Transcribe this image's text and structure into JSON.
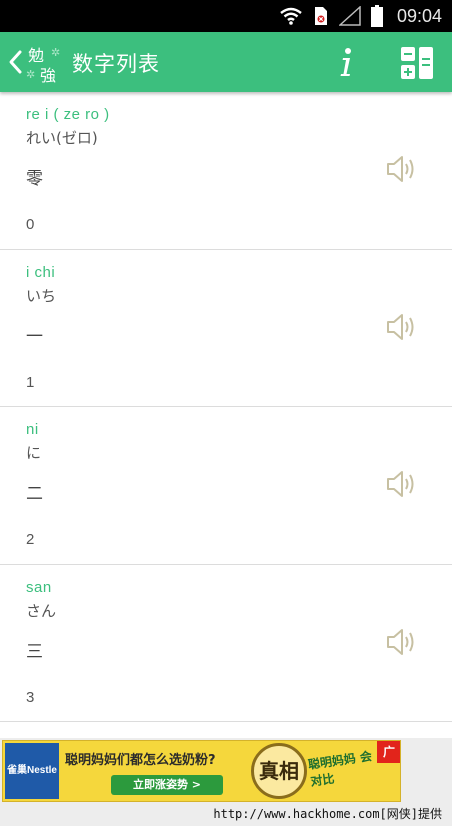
{
  "status_bar": {
    "time": "09:04",
    "icons": [
      "wifi-icon",
      "sim-icon",
      "signal-icon",
      "battery-icon"
    ]
  },
  "app_bar": {
    "logo_text": [
      "勉",
      "強"
    ],
    "title": "数字列表",
    "back_icon": "chevron-left-icon",
    "info_icon": "info-icon",
    "calculator_icon": "calculator-icon",
    "color": "#3cbf7e"
  },
  "numbers": [
    {
      "romaji": "re i ( ze ro )",
      "kana": "れい(ゼロ)",
      "kanji": "零",
      "digit": "0"
    },
    {
      "romaji": "i chi",
      "kana": "いち",
      "kanji": "一",
      "digit": "1"
    },
    {
      "romaji": "ni",
      "kana": "に",
      "kanji": "二",
      "digit": "2"
    },
    {
      "romaji": "san",
      "kana": "さん",
      "kanji": "三",
      "digit": "3"
    }
  ],
  "ad": {
    "brand": "雀巢Nestle",
    "headline": "聪明妈妈们都怎么选奶粉?",
    "cta": "立即涨姿势 >",
    "badge": "真相",
    "side_text": "聪明妈妈 会对比",
    "corner": "广"
  },
  "footer": {
    "watermark": "http://www.hackhome.com[网侠]提供"
  },
  "colors": {
    "accent": "#3cbf7e",
    "speaker": "#c7c0a2"
  }
}
